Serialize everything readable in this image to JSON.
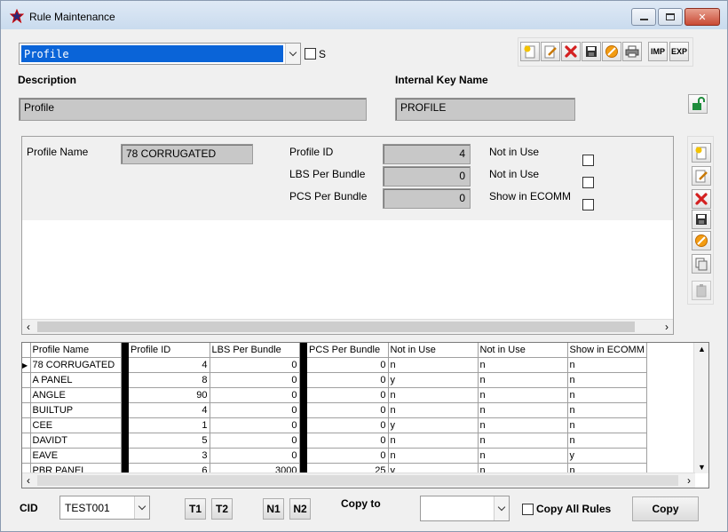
{
  "window": {
    "title": "Rule Maintenance"
  },
  "top": {
    "rule_select": "Profile",
    "s_label": "S",
    "description_label": "Description",
    "description_value": "Profile",
    "key_label": "Internal Key Name",
    "key_value": "PROFILE",
    "toolbar": {
      "imp": "IMP",
      "exp": "EXP"
    }
  },
  "form": {
    "profile_name_label": "Profile Name",
    "profile_name_value": "78 CORRUGATED",
    "profile_id_label": "Profile ID",
    "profile_id_value": "4",
    "lbs_label": "LBS Per Bundle",
    "lbs_value": "0",
    "pcs_label": "PCS Per Bundle",
    "pcs_value": "0",
    "not_in_use_1": "Not in Use",
    "not_in_use_2": "Not in Use",
    "show_ecomm": "Show in ECOMM"
  },
  "grid": {
    "columns": [
      "Profile Name",
      "Profile ID",
      "LBS Per Bundle",
      "PCS Per Bundle",
      "Not in Use",
      "Not in Use",
      "Show in ECOMM"
    ],
    "rows": [
      [
        "78 CORRUGATED",
        "4",
        "0",
        "0",
        "n",
        "n",
        "n"
      ],
      [
        "A PANEL",
        "8",
        "0",
        "0",
        "y",
        "n",
        "n"
      ],
      [
        "ANGLE",
        "90",
        "0",
        "0",
        "n",
        "n",
        "n"
      ],
      [
        "BUILTUP",
        "4",
        "0",
        "0",
        "n",
        "n",
        "n"
      ],
      [
        "CEE",
        "1",
        "0",
        "0",
        "y",
        "n",
        "n"
      ],
      [
        "DAVIDT",
        "5",
        "0",
        "0",
        "n",
        "n",
        "n"
      ],
      [
        "EAVE",
        "3",
        "0",
        "0",
        "n",
        "n",
        "y"
      ],
      [
        "PBR PANEL",
        "6",
        "3000",
        "25",
        "y",
        "n",
        "n"
      ]
    ]
  },
  "bottom": {
    "cid_label": "CID",
    "cid_value": "TEST001",
    "t1": "T1",
    "t2": "T2",
    "n1": "N1",
    "n2": "N2",
    "copy_to_label": "Copy to",
    "copy_to_value": "",
    "copy_all_label": "Copy All Rules",
    "copy_button": "Copy"
  }
}
